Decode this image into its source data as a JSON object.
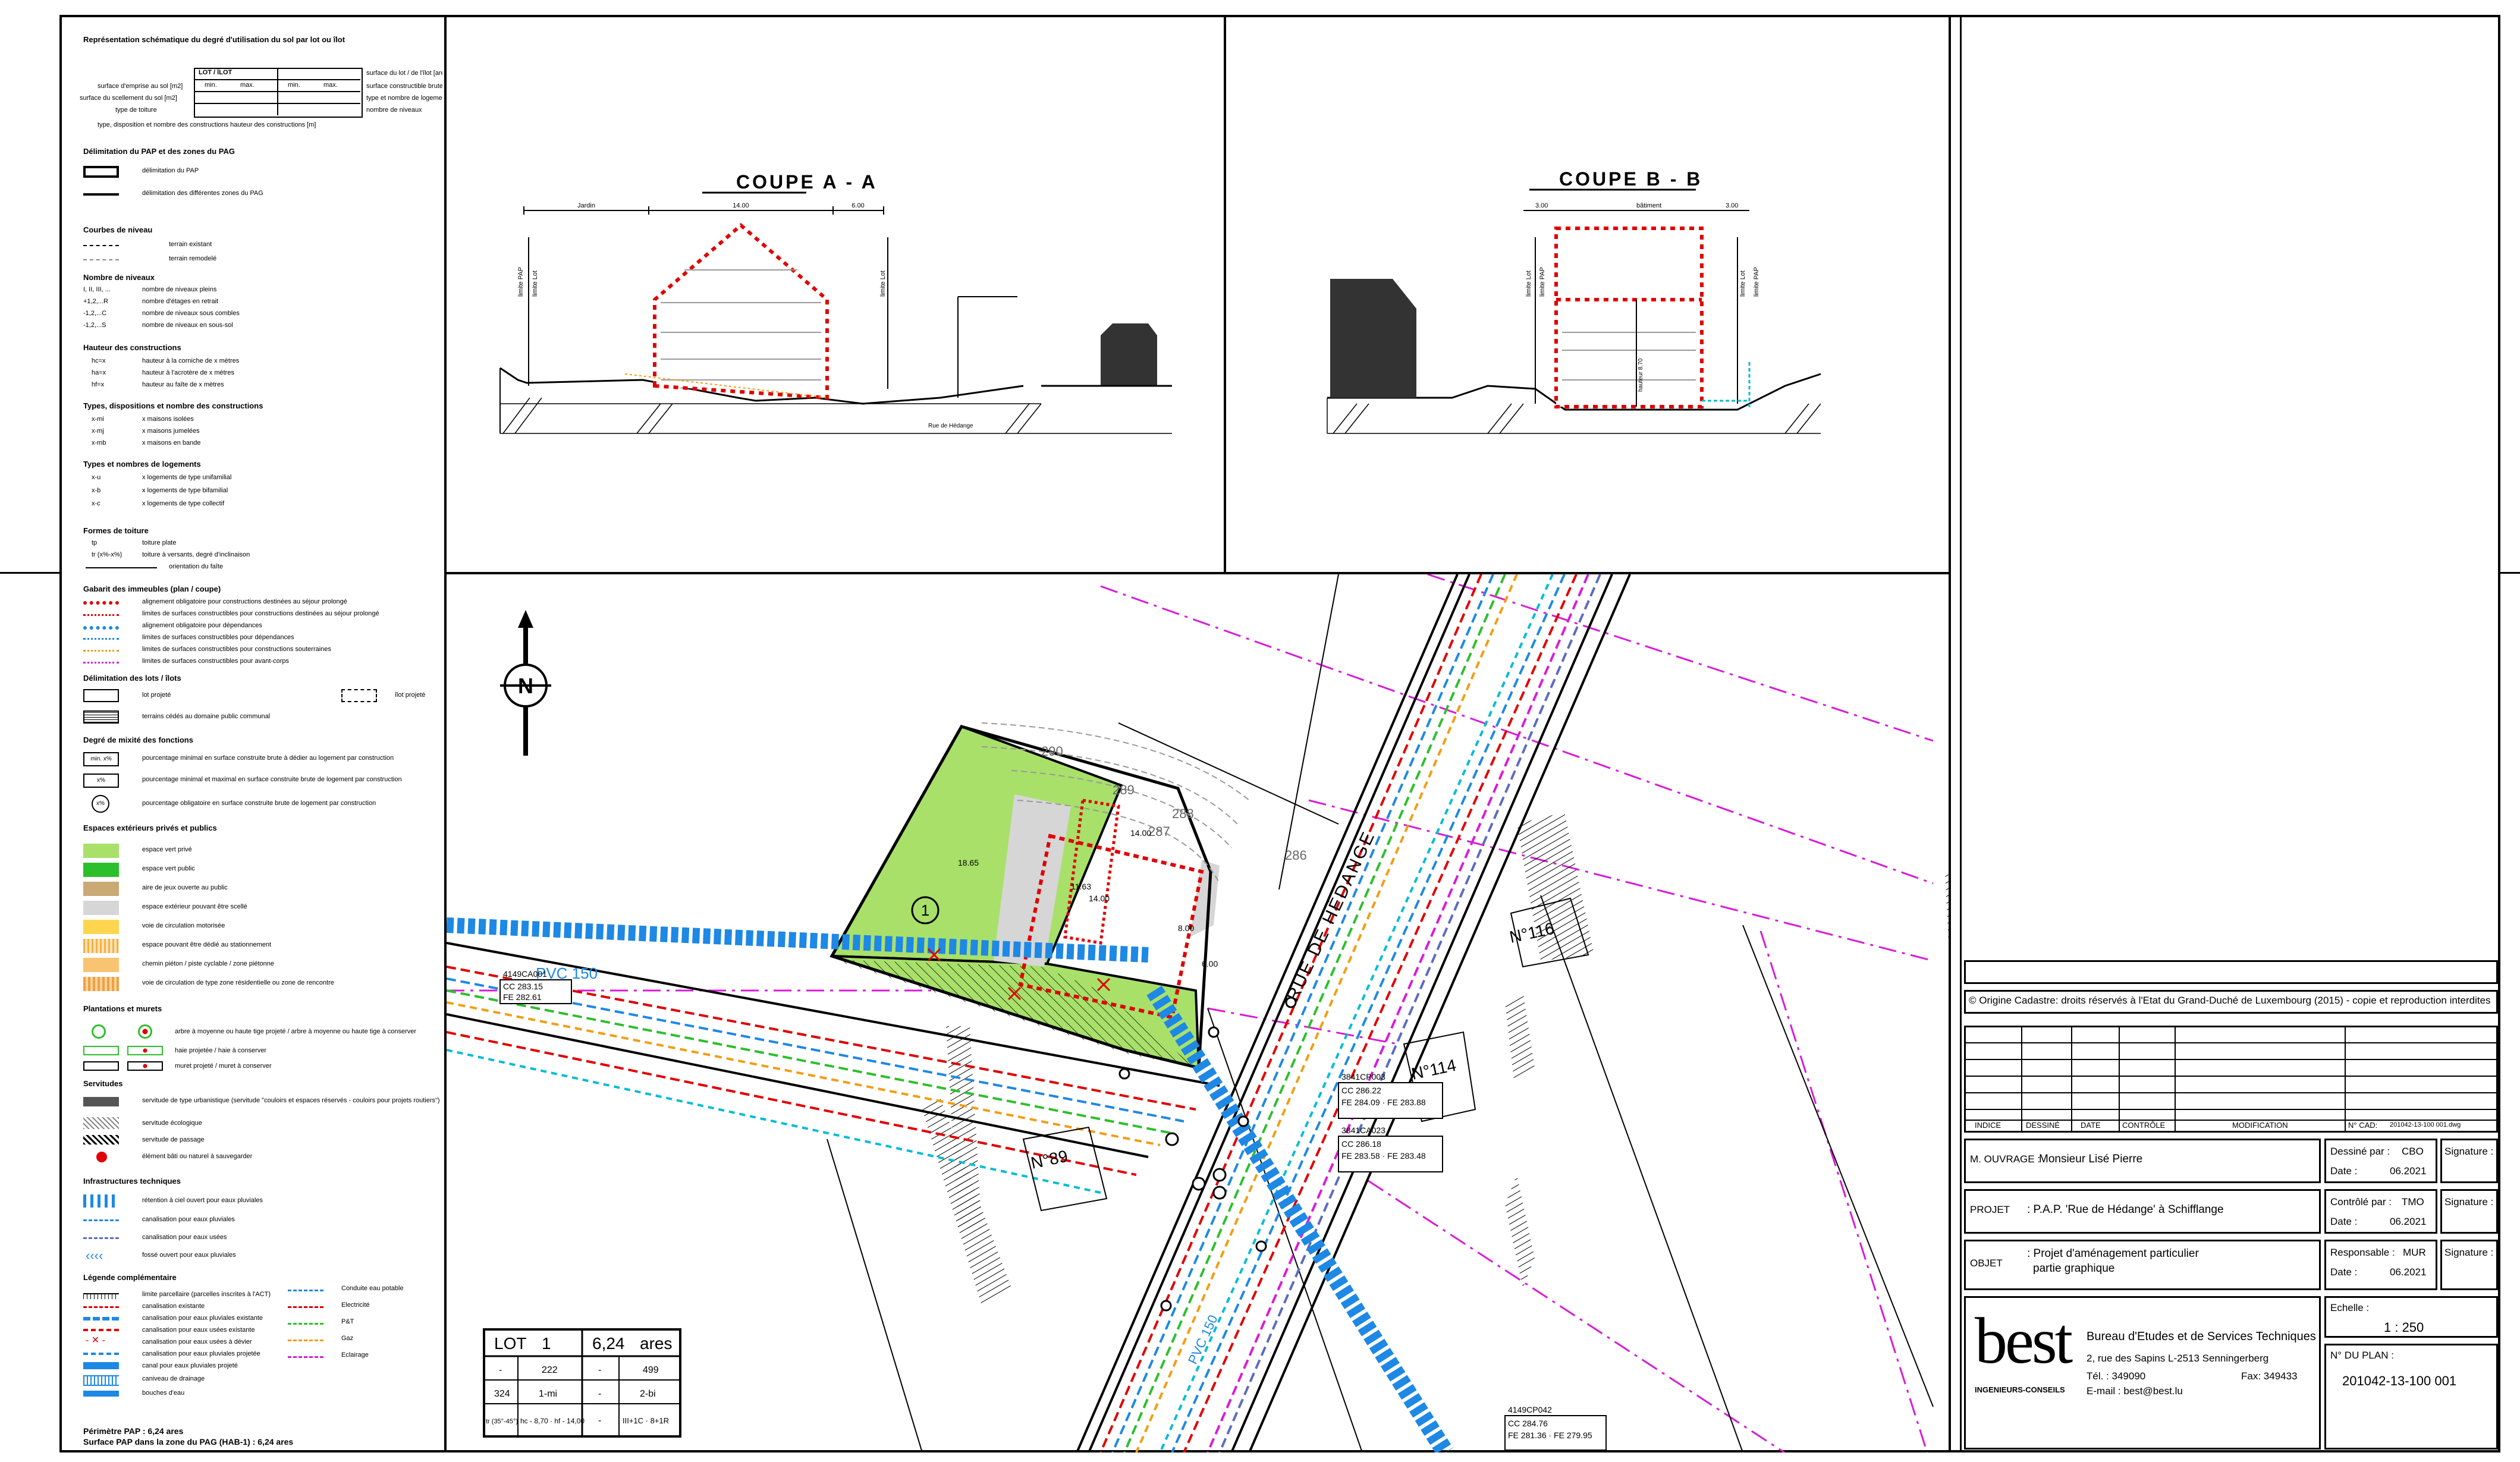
{
  "legend": {
    "header": "Représentation schématique du degré d'utilisation du sol par lot ou îlot",
    "schema": {
      "box_title": "LOT / ÎLOT",
      "min": "min.",
      "max": "max.",
      "left": [
        "surface d'emprise au sol [m2]",
        "surface du scellement du sol [m2]",
        "type de toiture"
      ],
      "right": [
        "surface du lot / de l'îlot [ares]",
        "surface constructible brute [m2]",
        "type et nombre de logements",
        "nombre de niveaux"
      ],
      "bottom": "type, disposition et nombre des constructions   hauteur des constructions [m]"
    },
    "sections": [
      {
        "title": "Délimitation du PAP et des zones du PAG",
        "items": [
          "délimitation du PAP",
          "délimitation des différentes zones du PAG"
        ]
      },
      {
        "title": "Courbes de niveau",
        "items": [
          "terrain existant",
          "terrain remodelé"
        ]
      },
      {
        "title": "Nombre de niveaux",
        "codes": [
          "I, II, III, ...",
          "+1,2,...R",
          "-1,2,...C",
          "-1,2,...S"
        ],
        "items": [
          "nombre de niveaux pleins",
          "nombre d'étages en retrait",
          "nombre de niveaux sous combles",
          "nombre de niveaux en sous-sol"
        ]
      },
      {
        "title": "Hauteur des constructions",
        "codes": [
          "hc=x",
          "ha=x",
          "hf=x"
        ],
        "items": [
          "hauteur à la corniche de x mètres",
          "hauteur à l'acrotère de x mètres",
          "hauteur au faîte de x mètres"
        ]
      },
      {
        "title": "Types, dispositions et nombre des constructions",
        "codes": [
          "x-mi",
          "x-mj",
          "x-mb"
        ],
        "items": [
          "x maisons isolées",
          "x maisons jumelées",
          "x maisons en bande"
        ]
      },
      {
        "title": "Types et nombres de logements",
        "codes": [
          "x-u",
          "x-b",
          "x-c"
        ],
        "items": [
          "x logements de type unifamilial",
          "x logements de type bifamilial",
          "x logements de type collectif"
        ]
      },
      {
        "title": "Formes de toiture",
        "codes": [
          "tp",
          "tr (x%-x%)"
        ],
        "items": [
          "toiture plate",
          "toiture à versants, degré d'inclinaison",
          "orientation du faîte"
        ]
      },
      {
        "title": "Gabarit des immeubles (plan / coupe)",
        "items": [
          "alignement obligatoire pour constructions destinées au séjour prolongé",
          "limites de surfaces constructibles pour constructions destinées au séjour prolongé",
          "alignement obligatoire pour dépendances",
          "limites de surfaces constructibles pour dépendances",
          "limites de surfaces constructibles pour constructions souterraines",
          "limites de surfaces constructibles pour avant-corps"
        ]
      },
      {
        "title": "Délimitation des lots / îlots",
        "items": [
          "lot projeté",
          "îlot projeté",
          "terrains cédés au domaine public communal"
        ]
      },
      {
        "title": "Degré de mixité des fonctions",
        "codes": [
          "min. x%",
          "x%",
          "x%"
        ],
        "items": [
          "pourcentage minimal en surface construite brute à dédier au logement par construction",
          "pourcentage minimal et maximal en surface construite brute de logement par construction",
          "pourcentage obligatoire en surface construite brute de logement par construction"
        ]
      },
      {
        "title": "Espaces extérieurs privés et publics",
        "items": [
          "espace vert privé",
          "espace vert public",
          "aire de jeux ouverte au public",
          "espace extérieur pouvant être scellé",
          "voie de circulation motorisée",
          "espace pouvant être dédié au stationnement",
          "chemin piéton / piste cyclable / zone piétonne",
          "voie de circulation de type zone résidentielle ou zone de rencontre"
        ]
      },
      {
        "title": "Plantations et murets",
        "items": [
          "arbre à moyenne ou haute tige projeté / arbre à moyenne ou haute tige à conserver",
          "haie projetée / haie à conserver",
          "muret projeté / muret à conserver"
        ]
      },
      {
        "title": "Servitudes",
        "items": [
          "servitude de type urbanistique (servitude \"couloirs et espaces réservés - couloirs pour projets routiers\")",
          "servitude écologique",
          "servitude de passage",
          "élément bâti ou naturel à sauvegarder"
        ]
      },
      {
        "title": "Infrastructures techniques",
        "items": [
          "rétention à ciel ouvert pour eaux pluviales",
          "canalisation pour eaux pluviales",
          "canalisation pour eaux usées",
          "fossé ouvert pour eaux pluviales"
        ]
      },
      {
        "title": "Légende complémentaire",
        "items": [
          "limite parcellaire (parcelles inscrites à l'ACT)",
          "canalisation existante",
          "canalisation pour eaux pluviales existante",
          "canalisation pour eaux usées existante",
          "canalisation pour eaux usées à dévier",
          "canalisation pour eaux pluviales projetée",
          "canal pour eaux pluviales projeté",
          "caniveau de drainage",
          "bouches d'eau"
        ],
        "items_right": [
          "Conduite eau potable",
          "Electricité",
          "P&T",
          "Gaz",
          "Eclairage"
        ]
      }
    ],
    "footer": [
      "Périmètre PAP : 6,24 ares",
      "Surface PAP dans la zone du PAG (HAB-1) : 6,24 ares"
    ]
  },
  "coupe_a": {
    "title": "COUPE A - A",
    "dims": [
      "Jardin",
      "14.00",
      "6.00"
    ],
    "limits": [
      "limite PAP",
      "limite Lot",
      "limite Lot"
    ],
    "road": "Rue de Hédange"
  },
  "coupe_b": {
    "title": "COUPE B - B",
    "dims": [
      "3.00",
      "bâtiment",
      "3.00"
    ],
    "limits": [
      "limite Lot",
      "limite PAP",
      "limite Lot",
      "limite PAP"
    ],
    "mid": "hauteur 8.70"
  },
  "plan": {
    "north": "N",
    "street": "RUE DE HÉDANGE",
    "pvc_label": "PVC 150",
    "pvc_label2": "PVC 150",
    "lot_circle": "1",
    "house_numbers": [
      "N°116",
      "N°114",
      "N°89"
    ],
    "parcels": [
      {
        "id": "4149CA001",
        "cc": "CC 283.15",
        "fe": "FE 282.61"
      },
      {
        "id": "3841CP003",
        "cc": "CC 286.22",
        "fe": "FE 284.09 · FE 283.88"
      },
      {
        "id": "3841CA023",
        "cc": "CC 286.18",
        "fe": "FE 283.58 · FE 283.48"
      },
      {
        "id": "4149CP042",
        "cc": "CC 284.76",
        "fe": "FE 281.36 · FE 279.95"
      }
    ],
    "contours": [
      "290",
      "289",
      "288",
      "287",
      "286"
    ],
    "dims": [
      "18.65",
      "14.00",
      "14.00",
      "11.63",
      "8.00",
      "6.00"
    ],
    "lot_table": {
      "row0": [
        "LOT",
        "1",
        "6,24",
        "ares"
      ],
      "row1": [
        "-",
        "222",
        "-",
        "499"
      ],
      "row2": [
        "324",
        "1-mi",
        "-",
        "2-bi"
      ],
      "row3": [
        "tr (35°-45°)",
        "hc - 8,70 · hf - 14,00",
        "-",
        "III+1C · 8+1R"
      ]
    }
  },
  "titleblock": {
    "copyright": "© Origine Cadastre: droits réservés à l'Etat du Grand-Duché de Luxembourg (2015) - copie et reproduction interdites",
    "index_headers": [
      "INDICE",
      "DESSINÉ",
      "DATE",
      "CONTRÔLE",
      "MODIFICATION",
      "N° CAD:"
    ],
    "cad_file": "201042-13-100 001.dwg",
    "m_ouvrage_label": "M. OUVRAGE :",
    "m_ouvrage": "Monsieur Lisé Pierre",
    "projet_label": "PROJET",
    "projet": ": P.A.P. 'Rue de Hédange' à Schifflange",
    "objet_label": "OBJET",
    "objet_1": ": Projet d'aménagement particulier",
    "objet_2": "partie graphique",
    "dessine_label": "Dessiné par :",
    "dessine": "CBO",
    "controle_label": "Contrôlé par :",
    "controle": "TMO",
    "responsable_label": "Responsable :",
    "responsable": "MUR",
    "date_label": "Date :",
    "date": "06.2021",
    "signature_label": "Signature :",
    "echelle_label": "Echelle :",
    "echelle": "1 : 250",
    "plan_no_label": "N° DU PLAN :",
    "plan_no": "201042-13-100 001",
    "company": {
      "logo": "best",
      "logo_sub": "INGENIEURS-CONSEILS",
      "name": "Bureau d'Etudes et de Services Techniques",
      "address": "2, rue des Sapins   L-2513 Senningerberg",
      "tel": "Tél. : 349090",
      "fax": "Fax: 349433",
      "email": "E-mail : best@best.lu"
    }
  },
  "colors": {
    "red": "#e00000",
    "blue": "#1e88e5",
    "green_private": "#a8e06a",
    "green_public": "#2cbf2c",
    "magenta": "#d81bd8",
    "orange": "#f39c12",
    "cyan": "#00bcd4"
  }
}
